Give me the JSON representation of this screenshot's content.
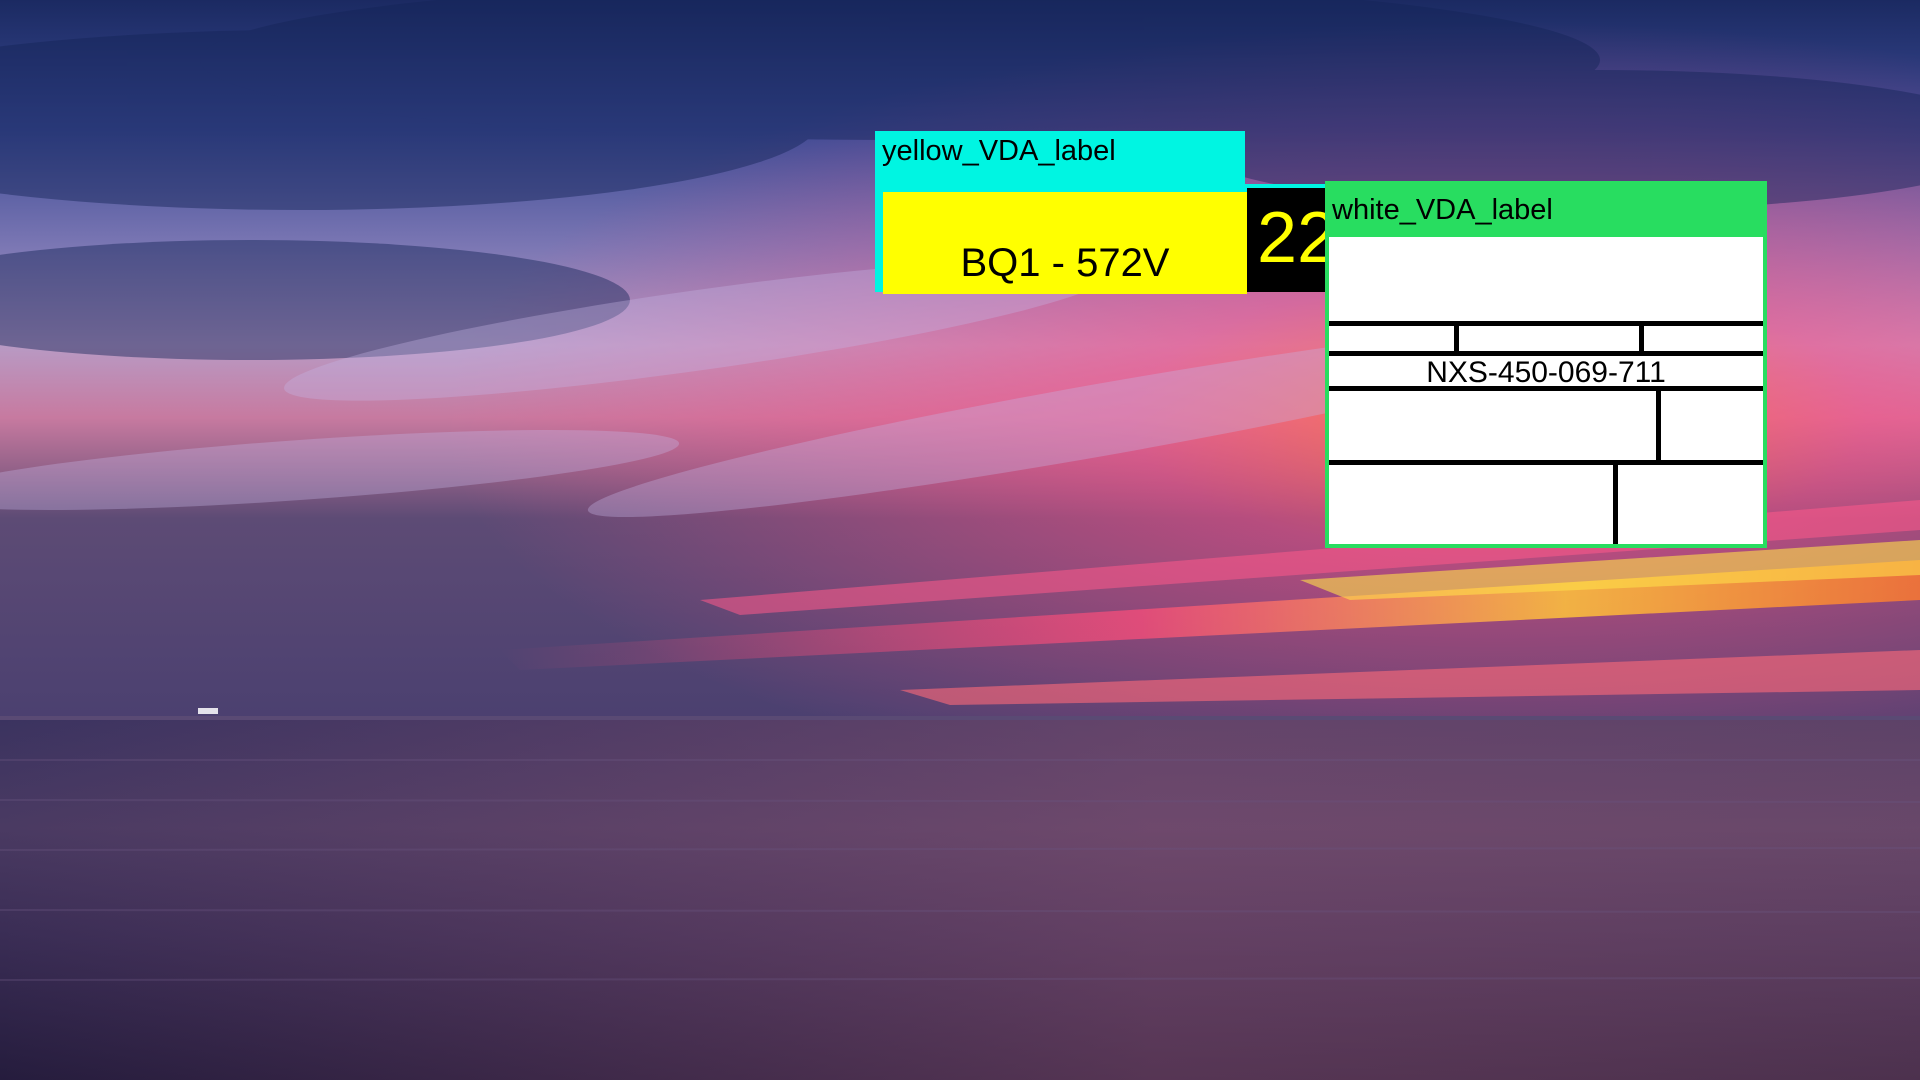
{
  "scene": {
    "description_colors": {
      "sky_top": "#1d2f6e",
      "sky_mid": "#8a7fb8",
      "sky_glow": "#ff5a86",
      "sun_band": "#ffd23a",
      "sea": "#2b2243"
    }
  },
  "annotations": {
    "yellow_label": {
      "tag": "yellow_VDA_label",
      "text": "BQ1 - 572V",
      "number": "22",
      "tag_color": "#00f5e2"
    },
    "white_label": {
      "tag": "white_VDA_label",
      "code": "NXS-450-069-711",
      "tag_color": "#28dd60"
    }
  }
}
